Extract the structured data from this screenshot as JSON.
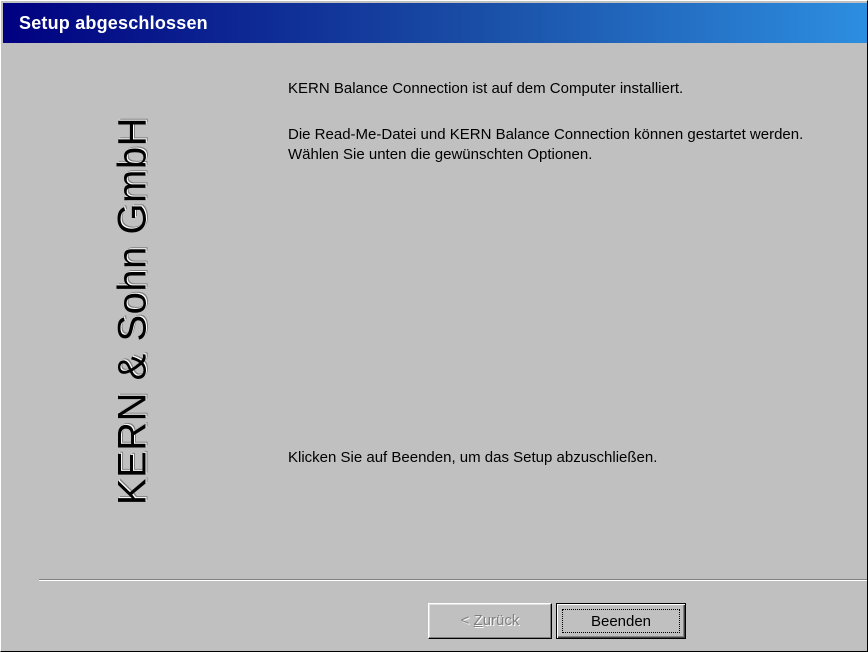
{
  "window": {
    "title": "Setup abgeschlossen"
  },
  "branding": {
    "vertical_logo_text": "KERN & Sohn GmbH"
  },
  "content": {
    "line_installed": "KERN Balance Connection ist auf dem Computer installiert.",
    "line_readme": "Die Read-Me-Datei und KERN Balance Connection können gestartet werden. Wählen Sie unten die gewünschten Optionen.",
    "line_finish_hint": "Klicken Sie auf Beenden, um das Setup abzuschließen."
  },
  "buttons": {
    "back_prefix": "< ",
    "back_mnemonic": "Z",
    "back_rest": "urück",
    "finish_label": "Beenden"
  },
  "colors": {
    "titlebar_start": "#000080",
    "titlebar_end": "#2d8ee0",
    "dialog_background": "#c0c0c0"
  }
}
